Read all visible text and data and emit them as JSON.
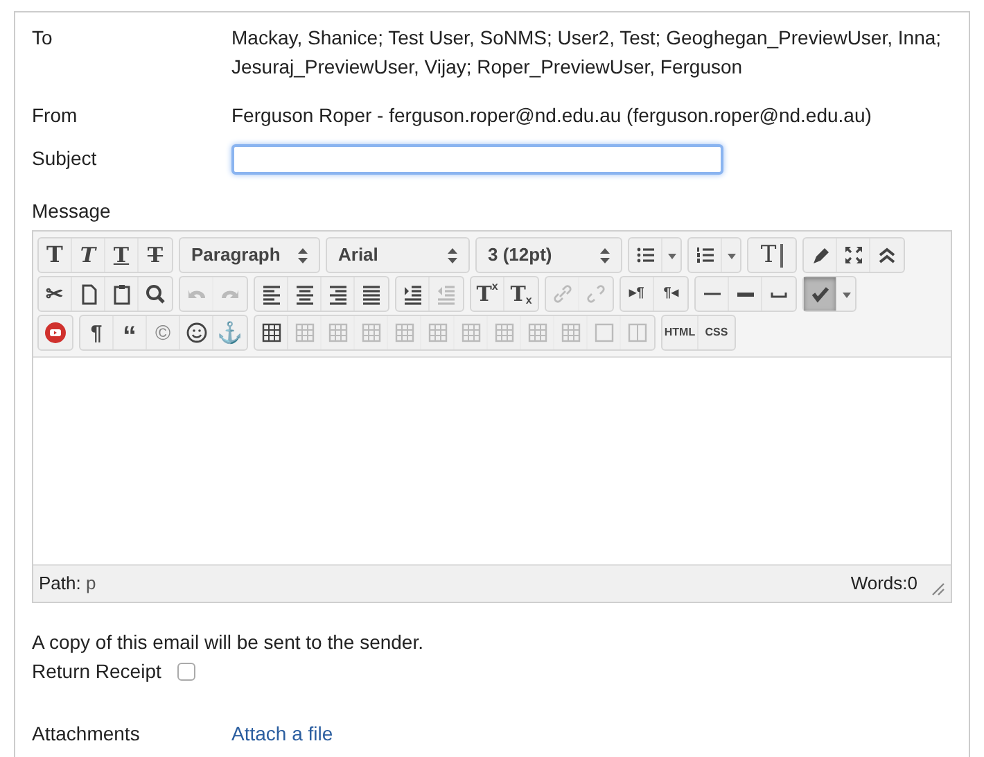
{
  "fields": [
    {
      "label": "To",
      "value": "Mackay, Shanice; Test User, SoNMS; User2, Test; Geoghegan_PreviewUser, Inna; Jesuraj_PreviewUser, Vijay; Roper_PreviewUser, Ferguson"
    },
    {
      "label": "From",
      "value": "Ferguson Roper - ferguson.roper@nd.edu.au (ferguson.roper@nd.edu.au)"
    }
  ],
  "subject": {
    "label": "Subject",
    "focused": true
  },
  "message": {
    "label": "Message",
    "toolbar": [
      [
        [
          {
            "kind": "bold",
            "glyph": "T",
            "disabled": false,
            "pressed": false
          },
          {
            "kind": "italic",
            "glyph": "T",
            "disabled": false,
            "pressed": false
          },
          {
            "kind": "underline",
            "glyph": "T",
            "disabled": false,
            "pressed": false
          },
          {
            "kind": "strike",
            "glyph": "T",
            "disabled": false,
            "pressed": false
          }
        ],
        [
          {
            "kind": "select",
            "value": "Paragraph",
            "disabled": false,
            "pressed": false
          }
        ],
        [
          {
            "kind": "select",
            "value": "Arial",
            "disabled": false,
            "pressed": false
          }
        ],
        [
          {
            "kind": "select",
            "value": "3 (12pt)",
            "disabled": false,
            "pressed": false
          }
        ],
        [
          {
            "kind": "ul",
            "disabled": false,
            "pressed": false
          },
          {
            "kind": "caret",
            "disabled": false,
            "pressed": false
          }
        ],
        [
          {
            "kind": "ol",
            "disabled": false,
            "pressed": false
          },
          {
            "kind": "caret",
            "disabled": false,
            "pressed": false
          }
        ],
        [
          {
            "kind": "clear",
            "glyph": "T",
            "disabled": false,
            "pressed": false
          }
        ],
        [
          {
            "kind": "highlighter",
            "disabled": false,
            "pressed": false
          },
          {
            "kind": "fullscreen",
            "disabled": false,
            "pressed": false
          },
          {
            "kind": "collapse",
            "disabled": false,
            "pressed": false
          }
        ]
      ],
      [
        [
          {
            "kind": "cut",
            "glyph": "✂",
            "disabled": false,
            "pressed": false
          },
          {
            "kind": "page",
            "disabled": false,
            "pressed": false
          },
          {
            "kind": "paste",
            "disabled": false,
            "pressed": false
          },
          {
            "kind": "find",
            "disabled": false,
            "pressed": false
          }
        ],
        [
          {
            "kind": "undo",
            "disabled": true,
            "pressed": false
          },
          {
            "kind": "redo",
            "disabled": true,
            "pressed": false
          }
        ],
        [
          {
            "kind": "align-left",
            "disabled": false,
            "pressed": false
          },
          {
            "kind": "align-center",
            "disabled": false,
            "pressed": false
          },
          {
            "kind": "align-right",
            "disabled": false,
            "pressed": false
          },
          {
            "kind": "justify",
            "disabled": false,
            "pressed": false
          }
        ],
        [
          {
            "kind": "indent",
            "disabled": false,
            "pressed": false
          },
          {
            "kind": "outdent",
            "disabled": true,
            "pressed": false
          }
        ],
        [
          {
            "kind": "sup",
            "glyph": "T",
            "mark": "x",
            "disabled": false,
            "pressed": false
          },
          {
            "kind": "sub",
            "glyph": "T",
            "mark": "x",
            "disabled": false,
            "pressed": false
          }
        ],
        [
          {
            "kind": "link",
            "disabled": true,
            "pressed": false
          },
          {
            "kind": "unlink",
            "disabled": true,
            "pressed": false
          }
        ],
        [
          {
            "kind": "ltr",
            "glyph": "▸¶",
            "disabled": false,
            "pressed": false
          },
          {
            "kind": "rtl",
            "glyph": "¶◂",
            "disabled": false,
            "pressed": false
          }
        ],
        [
          {
            "kind": "hr",
            "disabled": false,
            "pressed": false
          },
          {
            "kind": "hr-thick",
            "disabled": false,
            "pressed": false
          },
          {
            "kind": "nbsp",
            "disabled": false,
            "pressed": false
          }
        ],
        [
          {
            "kind": "spell",
            "disabled": false,
            "pressed": true
          },
          {
            "kind": "caret",
            "disabled": false,
            "pressed": false
          }
        ]
      ],
      [
        [
          {
            "kind": "media",
            "disabled": false,
            "pressed": false
          }
        ],
        [
          {
            "kind": "para",
            "glyph": "¶",
            "disabled": false,
            "pressed": false
          },
          {
            "kind": "quote",
            "glyph": "“",
            "disabled": false,
            "pressed": false
          },
          {
            "kind": "copyright",
            "glyph": "©",
            "disabled": false,
            "pressed": false
          },
          {
            "kind": "smile",
            "disabled": false,
            "pressed": false
          },
          {
            "kind": "anchor",
            "glyph": "⚓",
            "disabled": false,
            "pressed": false
          }
        ],
        [
          {
            "kind": "table",
            "disabled": false,
            "pressed": false
          },
          {
            "kind": "table",
            "disabled": true,
            "pressed": false
          },
          {
            "kind": "table",
            "disabled": true,
            "pressed": false
          },
          {
            "kind": "table",
            "disabled": true,
            "pressed": false
          },
          {
            "kind": "table",
            "disabled": true,
            "pressed": false
          },
          {
            "kind": "table",
            "disabled": true,
            "pressed": false
          },
          {
            "kind": "table",
            "disabled": true,
            "pressed": false
          },
          {
            "kind": "table",
            "disabled": true,
            "pressed": false
          },
          {
            "kind": "table",
            "disabled": true,
            "pressed": false
          },
          {
            "kind": "table",
            "disabled": true,
            "pressed": false
          },
          {
            "kind": "box",
            "disabled": true,
            "pressed": false
          },
          {
            "kind": "split",
            "disabled": true,
            "pressed": false
          }
        ],
        [
          {
            "kind": "code",
            "glyph": "HTML",
            "disabled": false,
            "pressed": false
          },
          {
            "kind": "code",
            "glyph": "CSS",
            "disabled": false,
            "pressed": false
          }
        ]
      ]
    ],
    "path_label": "Path:",
    "path": "p",
    "words": "Words:0"
  },
  "copy_note": "A copy of this email will be sent to the sender.",
  "receipt": {
    "label": "Return Receipt",
    "checked": false
  },
  "attachments": {
    "label": "Attachments",
    "link": "Attach a file"
  }
}
